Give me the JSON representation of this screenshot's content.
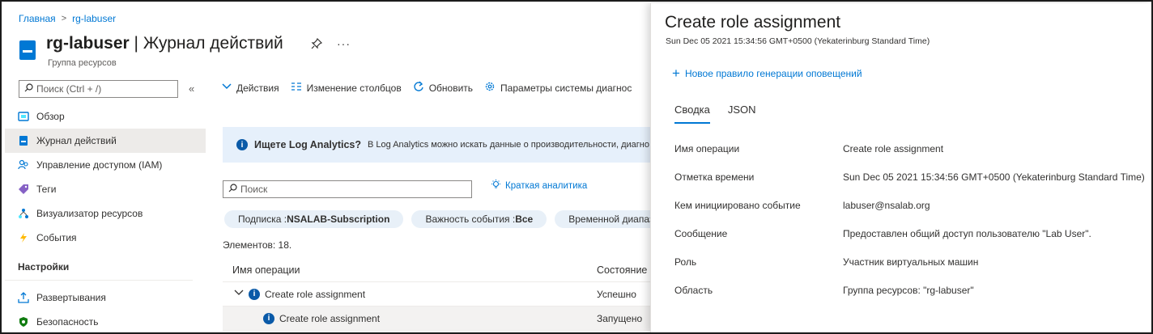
{
  "breadcrumb": {
    "home": "Главная",
    "separator": ">",
    "current": "rg-labuser"
  },
  "header": {
    "resource": "rg-labuser",
    "divider": " | ",
    "page": "Журнал действий",
    "pin_icon": "pin-icon",
    "more": "···",
    "subtitle": "Группа ресурсов"
  },
  "sidebar": {
    "search_placeholder": "Поиск (Ctrl + /)",
    "collapse": "«",
    "items": [
      {
        "label": "Обзор",
        "icon": "overview-icon",
        "color": "#0078d4"
      },
      {
        "label": "Журнал действий",
        "icon": "activity-log-icon",
        "color": "#0078d4",
        "active": true
      },
      {
        "label": "Управление доступом (IAM)",
        "icon": "iam-icon",
        "color": "#0078d4"
      },
      {
        "label": "Теги",
        "icon": "tag-icon",
        "color": "#8661c5"
      },
      {
        "label": "Визуализатор ресурсов",
        "icon": "resource-visualizer-icon",
        "color": "#0078d4"
      },
      {
        "label": "События",
        "icon": "events-icon",
        "color": "#ffb900"
      }
    ],
    "section": "Настройки",
    "settings_items": [
      {
        "label": "Развертывания",
        "icon": "deployments-icon",
        "color": "#0078d4"
      },
      {
        "label": "Безопасность",
        "icon": "security-icon",
        "color": "#107c10"
      }
    ]
  },
  "toolbar": {
    "actions": "Действия",
    "columns": "Изменение столбцов",
    "refresh": "Обновить",
    "diagnostics": "Параметры системы диагнос"
  },
  "info": {
    "title": "Ищете Log Analytics?",
    "text": "В Log Analytics можно искать данные о производительности, диагно"
  },
  "search": {
    "placeholder": "Поиск"
  },
  "insights": "Краткая аналитика",
  "filters": [
    {
      "label": "Подписка : ",
      "value": "NSALAB-Subscription"
    },
    {
      "label": "Важность события : ",
      "value": "Все"
    },
    {
      "label": "Временной диапаз",
      "value": ""
    }
  ],
  "table": {
    "count": "Элементов: 18.",
    "headers": {
      "name": "Имя операции",
      "status": "Состояние"
    },
    "rows": [
      {
        "name": "Create role assignment",
        "status": "Успешно",
        "expandable": true
      },
      {
        "name": "Create role assignment",
        "status": "Запущено",
        "expandable": false
      }
    ]
  },
  "detail": {
    "title": "Create role assignment",
    "timestamp": "Sun Dec 05 2021 15:34:56 GMT+0500 (Yekaterinburg Standard Time)",
    "new_rule": "Новое правило генерации оповещений",
    "tabs": [
      "Сводка",
      "JSON"
    ],
    "properties": [
      {
        "key": "Имя операции",
        "value": "Create role assignment"
      },
      {
        "key": "Отметка времени",
        "value": "Sun Dec 05 2021 15:34:56 GMT+0500 (Yekaterinburg Standard Time)"
      },
      {
        "key": "Кем инициировано событие",
        "value": "labuser@nsalab.org"
      },
      {
        "key": "Сообщение",
        "value": "Предоставлен общий доступ пользователю \"Lab User\"."
      },
      {
        "key": "Роль",
        "value": "Участник виртуальных машин"
      },
      {
        "key": "Область",
        "value": "Группа ресурсов: \"rg-labuser\""
      }
    ]
  },
  "colors": {
    "accent": "#0078d4",
    "info_bg": "#e6f0fb",
    "pill_bg": "#e8f0f8",
    "active_nav_bg": "#edebe9"
  }
}
